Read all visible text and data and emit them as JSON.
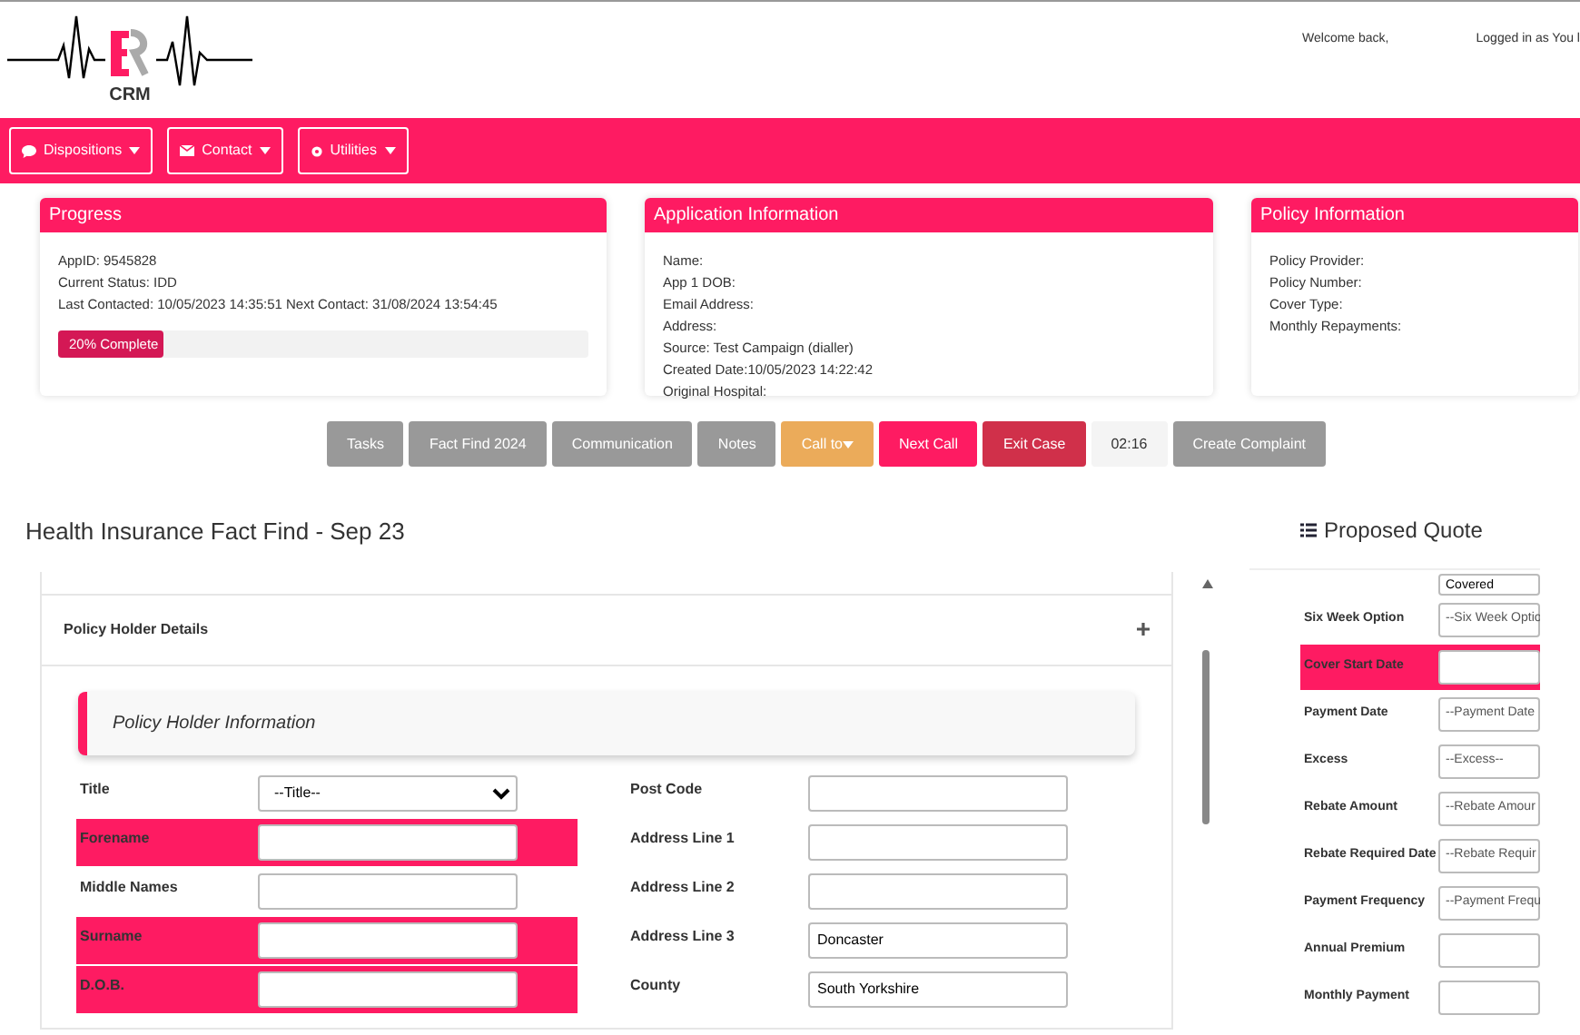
{
  "header": {
    "logo_text": "CRM",
    "welcome": "Welcome back,",
    "logged_in": "Logged in as You l"
  },
  "navbar": {
    "menus": [
      {
        "label": "Dispositions"
      },
      {
        "label": "Contact"
      },
      {
        "label": "Utilities"
      }
    ]
  },
  "cards": [
    {
      "title": "Progress",
      "lines": [
        "AppID: 9545828",
        "Current Status: IDD",
        "Last Contacted: 10/05/2023 14:35:51 Next Contact: 31/08/2024 13:54:45"
      ],
      "progress": {
        "label": "20% Complete",
        "level": 0.2
      }
    },
    {
      "title": "Application Information",
      "lines": [
        "Name:",
        "App 1 DOB:",
        "Email Address:",
        "Address:",
        "Source: Test Campaign (dialler)",
        "Created Date:10/05/2023 14:22:42",
        "Original Hospital:"
      ]
    },
    {
      "title": "Policy Information",
      "lines": [
        "Policy Provider:",
        "Policy Number:",
        "Cover Type:",
        "Monthly Repayments:"
      ]
    }
  ],
  "actions": [
    {
      "label": "Tasks",
      "kind": "grey"
    },
    {
      "label": "Fact Find 2024",
      "kind": "grey"
    },
    {
      "label": "Communication",
      "kind": "grey"
    },
    {
      "label": "Notes",
      "kind": "grey"
    },
    {
      "label": "Call to",
      "kind": "orange"
    },
    {
      "label": "Next Call",
      "kind": "pink"
    },
    {
      "label": "Exit Case",
      "kind": "red"
    },
    {
      "label": "02:16",
      "kind": "timer"
    },
    {
      "label": "Create Complaint",
      "kind": "grey"
    }
  ],
  "fact_find": {
    "title": "Health Insurance Fact Find - Sep 23",
    "section": "Policy Holder Details",
    "subsection": "Policy Holder Information",
    "left_fields": [
      {
        "label": "Title",
        "kind": "select",
        "value": "--Title--",
        "required": false
      },
      {
        "label": "Forename",
        "kind": "text",
        "required": true
      },
      {
        "label": "Middle Names",
        "kind": "text",
        "required": false
      },
      {
        "label": "Surname",
        "kind": "text",
        "required": true
      },
      {
        "label": "D.O.B.",
        "kind": "text",
        "required": true
      }
    ],
    "right_fields": [
      {
        "label": "Post Code",
        "kind": "text",
        "required": false
      },
      {
        "label": "Address Line 1",
        "kind": "text",
        "required": false
      },
      {
        "label": "Address Line 2",
        "kind": "text",
        "required": false
      },
      {
        "label": "Address Line 3",
        "kind": "text",
        "value": "Doncaster",
        "required": false
      },
      {
        "label": "County",
        "kind": "text",
        "value": "South Yorkshire",
        "required": false
      }
    ]
  },
  "proposed_quote": {
    "title": "Proposed Quote",
    "fields": [
      {
        "kind": "text",
        "value": "Covered",
        "required": false
      },
      {
        "label": "Six Week Option",
        "kind": "select",
        "value": "--Six Week Optio",
        "required": false
      },
      {
        "label": "Cover Start Date",
        "kind": "text",
        "required": true
      },
      {
        "label": "Payment Date",
        "kind": "select",
        "value": "--Payment Date",
        "required": false
      },
      {
        "label": "Excess",
        "kind": "select",
        "value": "--Excess--",
        "required": false
      },
      {
        "label": "Rebate Amount",
        "kind": "select",
        "value": "--Rebate Amour",
        "required": false
      },
      {
        "label": "Rebate Required Date",
        "kind": "select",
        "value": "--Rebate Requir",
        "required": false
      },
      {
        "label": "Payment Frequency",
        "kind": "select",
        "value": "--Payment Frequ",
        "required": false
      },
      {
        "label": "Annual Premium",
        "kind": "text",
        "required": false
      },
      {
        "label": "Monthly Payment",
        "kind": "text",
        "required": false
      }
    ]
  }
}
